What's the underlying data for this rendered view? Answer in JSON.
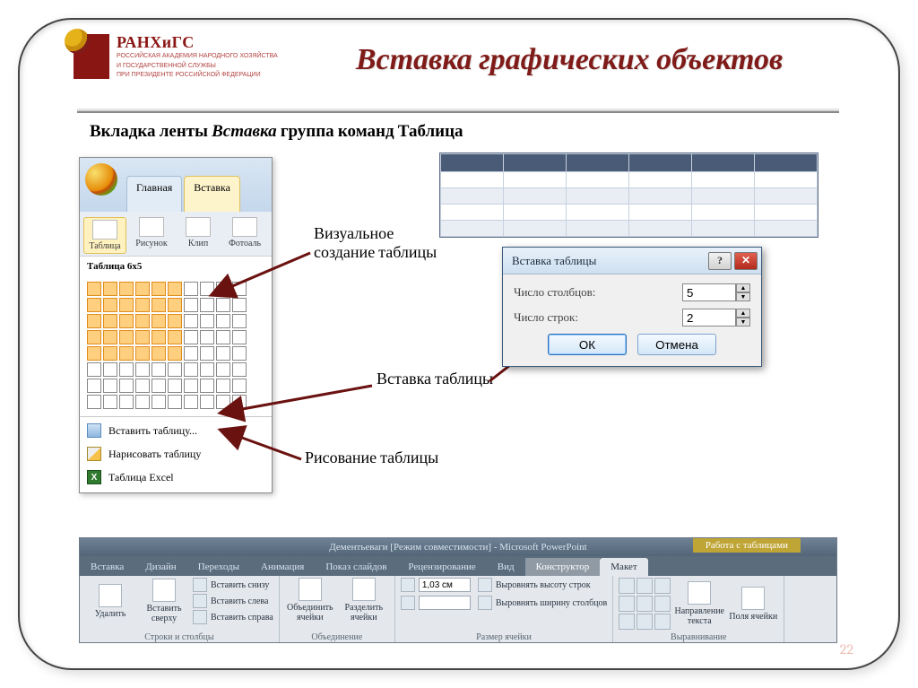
{
  "logo": {
    "title": "РАНХиГС",
    "sub1": "РОССИЙСКАЯ АКАДЕМИЯ НАРОДНОГО ХОЗЯЙСТВА",
    "sub2": "И ГОСУДАРСТВЕННОЙ СЛУЖБЫ",
    "sub3": "ПРИ ПРЕЗИДЕНТЕ РОССИЙСКОЙ ФЕДЕРАЦИИ"
  },
  "title": "Вставка графических объектов",
  "caption": {
    "p1": "Вкладка ленты ",
    "ital": "Вставка",
    "p2": "  группа команд ",
    "bold": "Таблица"
  },
  "dropdown": {
    "tabs": [
      "Главная",
      "Вставка"
    ],
    "ribbon": [
      {
        "label": "Таблица"
      },
      {
        "label": "Рисунок"
      },
      {
        "label": "Клип"
      },
      {
        "label": "Фотоаль"
      }
    ],
    "size_label": "Таблица 6x5",
    "grid": {
      "cols": 10,
      "rows": 8,
      "sel_cols": 6,
      "sel_rows": 5
    },
    "menu": {
      "insert": "Вставить таблицу...",
      "draw": "Нарисовать таблицу",
      "excel": "Таблица Excel"
    }
  },
  "labels": {
    "visual": "Визуальное создание таблицы",
    "insert": "Вставка таблицы",
    "draw": "Рисование таблицы"
  },
  "dialog": {
    "title": "Вставка таблицы",
    "help": "?",
    "close": "✕",
    "cols_label": "Число столбцов:",
    "cols_value": "5",
    "rows_label": "Число строк:",
    "rows_value": "2",
    "ok": "ОК",
    "cancel": "Отмена"
  },
  "ribbon": {
    "doc_title": "Дементьеваги [Режим совместимости] - Microsoft PowerPoint",
    "context": "Работа с таблицами",
    "tabs": [
      "Вставка",
      "Дизайн",
      "Переходы",
      "Анимация",
      "Показ слайдов",
      "Рецензирование",
      "Вид",
      "Конструктор",
      "Макет"
    ],
    "active_tab": "Макет",
    "groups": {
      "del": "Удалить",
      "ins_top": "Вставить сверху",
      "ins_bottom": "Вставить снизу",
      "ins_left": "Вставить слева",
      "ins_right": "Вставить справа",
      "g_rowscols": "Строки и столбцы",
      "merge": "Объединить ячейки",
      "split": "Разделить ячейки",
      "g_merge": "Объединение",
      "height": "1,03 см",
      "width": "",
      "fitH": "Выровнять высоту строк",
      "fitW": "Выровнять ширину столбцов",
      "g_size": "Размер ячейки",
      "textdir": "Направление текста",
      "cellmargin": "Поля ячейки",
      "g_align": "Выравнивание"
    }
  },
  "page_num": "22"
}
